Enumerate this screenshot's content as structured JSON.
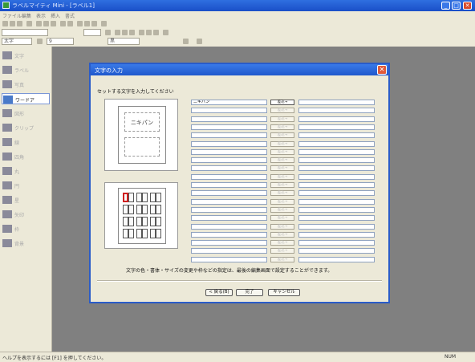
{
  "window": {
    "title": "ラベルマイティ Mini - [ラベル1]",
    "minimize_label": "_",
    "maximize_label": "□",
    "close_label": "✕"
  },
  "menu": [
    "ファイル",
    "編集",
    "表示",
    "挿入",
    "書式"
  ],
  "toolbar3": {
    "font_combo": "太字",
    "size_combo": "9",
    "color_combo": "黒"
  },
  "sidebar": {
    "items": [
      {
        "label": "文字",
        "icon": "text-icon"
      },
      {
        "label": "ラベル",
        "icon": "label-icon"
      },
      {
        "label": "写真",
        "icon": "photo-icon"
      },
      {
        "label": "ワードア",
        "icon": "wordart-icon"
      },
      {
        "label": "図形",
        "icon": "shape-icon"
      },
      {
        "label": "クリップ",
        "icon": "clip-icon"
      },
      {
        "label": "線",
        "icon": "line-icon"
      },
      {
        "label": "四角",
        "icon": "rect-icon"
      },
      {
        "label": "丸",
        "icon": "circle-icon"
      },
      {
        "label": "円",
        "icon": "ellipse-icon"
      },
      {
        "label": "星",
        "icon": "star-icon"
      },
      {
        "label": "矢印",
        "icon": "arrow-icon"
      },
      {
        "label": "枠",
        "icon": "frame-icon"
      },
      {
        "label": "背景",
        "icon": "background-icon"
      }
    ]
  },
  "dialog": {
    "title": "文字の入力",
    "prompt": "セットする文字を入力してください",
    "preview_text": "ニキパン",
    "rows": [
      {
        "value": "ニキパン",
        "button": "差込→",
        "enabled": true
      },
      {
        "value": "",
        "button": "差込→",
        "enabled": false
      },
      {
        "value": "",
        "button": "差込→",
        "enabled": false
      },
      {
        "value": "",
        "button": "差込→",
        "enabled": false
      },
      {
        "value": "",
        "button": "差込→",
        "enabled": false
      },
      {
        "value": "",
        "button": "差込→",
        "enabled": false
      },
      {
        "value": "",
        "button": "差込→",
        "enabled": false
      },
      {
        "value": "",
        "button": "差込→",
        "enabled": false
      },
      {
        "value": "",
        "button": "差込→",
        "enabled": false
      },
      {
        "value": "",
        "button": "差込→",
        "enabled": false
      },
      {
        "value": "",
        "button": "差込→",
        "enabled": false
      },
      {
        "value": "",
        "button": "差込→",
        "enabled": false
      },
      {
        "value": "",
        "button": "差込→",
        "enabled": false
      },
      {
        "value": "",
        "button": "差込→",
        "enabled": false
      },
      {
        "value": "",
        "button": "差込→",
        "enabled": false
      },
      {
        "value": "",
        "button": "差込→",
        "enabled": false
      },
      {
        "value": "",
        "button": "差込→",
        "enabled": false
      },
      {
        "value": "",
        "button": "差込→",
        "enabled": false
      },
      {
        "value": "",
        "button": "差込→",
        "enabled": false
      },
      {
        "value": "",
        "button": "差込→",
        "enabled": false
      }
    ],
    "note": "文字の色・書体・サイズの変更や枠などの指定は、最後の編集画面で設定することができます。",
    "buttons": {
      "back": "< 戻る(B)",
      "finish": "完了",
      "cancel": "キャンセル"
    }
  },
  "status": {
    "left": "ヘルプを表示するには [F1] を押してください。",
    "right": "NUM"
  },
  "colors": {
    "titlebar": "#1f58cc",
    "workspace": "#808080",
    "selection": "#d02020"
  }
}
